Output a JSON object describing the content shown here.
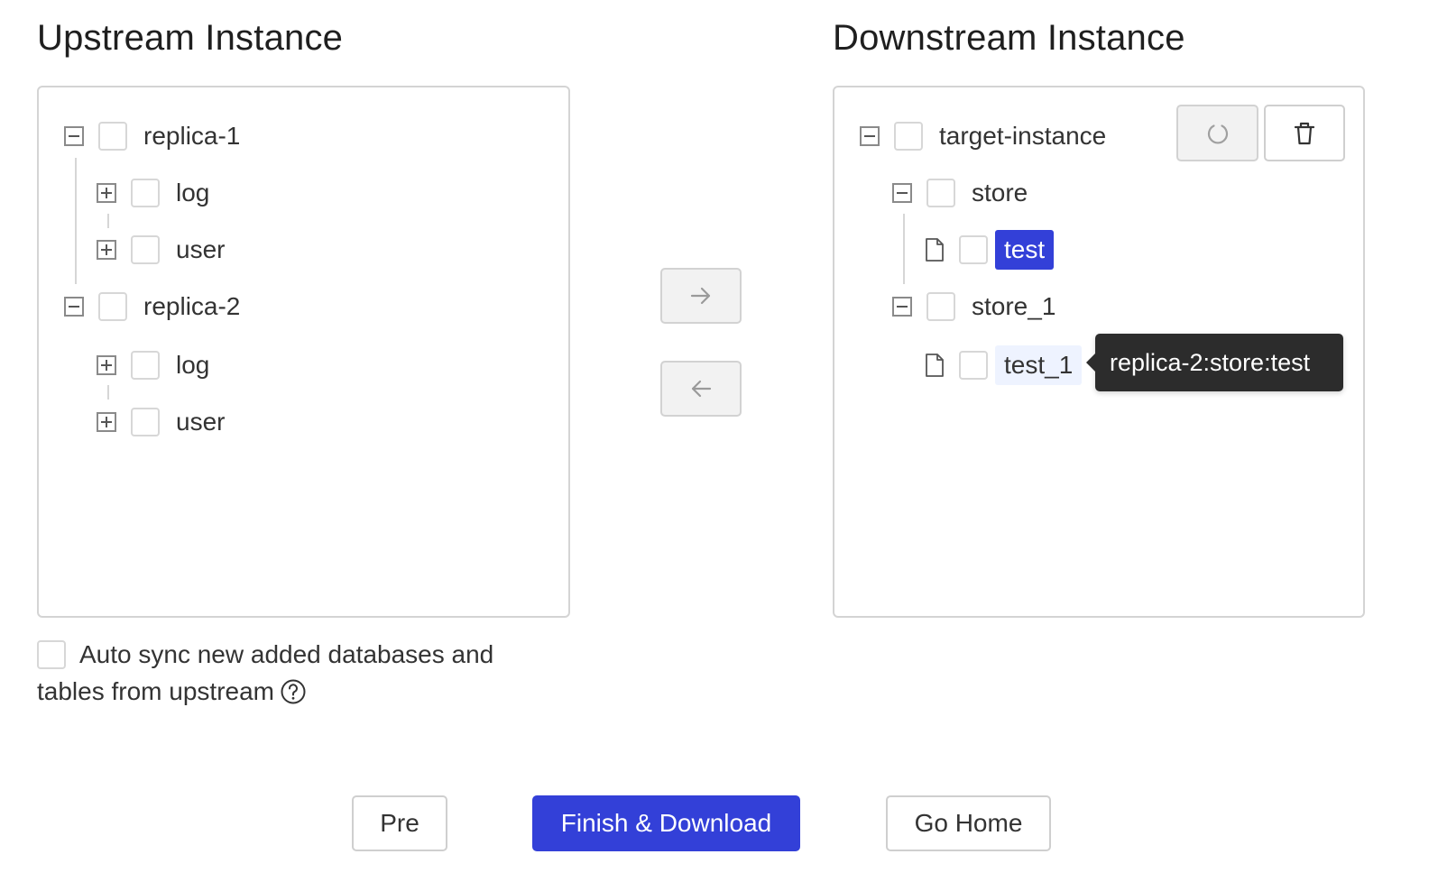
{
  "upstream": {
    "title": "Upstream Instance",
    "tree": [
      {
        "label": "replica-1",
        "children": [
          "log",
          "user"
        ]
      },
      {
        "label": "replica-2",
        "children": [
          "log",
          "user"
        ]
      }
    ]
  },
  "downstream": {
    "title": "Downstream Instance",
    "root": "target-instance",
    "dbs": [
      {
        "label": "store",
        "tables": [
          "test"
        ]
      },
      {
        "label": "store_1",
        "tables": [
          "test_1"
        ]
      }
    ],
    "tooltip": "replica-2:store:test"
  },
  "transfer": {
    "right_icon": "arrow-right-icon",
    "left_icon": "arrow-left-icon"
  },
  "toolbar": {
    "reset_icon": "reset-icon",
    "delete_icon": "trash-icon"
  },
  "auto_sync": {
    "line1": "Auto sync new added databases and",
    "line2": "tables from upstream",
    "help_icon": "question-circle-icon"
  },
  "footer": {
    "pre": "Pre",
    "finish": "Finish & Download",
    "home": "Go Home"
  },
  "colors": {
    "primary": "#3340d8",
    "border": "#d4d4d4",
    "tooltip_bg": "#2c2c2c",
    "hover_bg": "#eef3ff"
  }
}
